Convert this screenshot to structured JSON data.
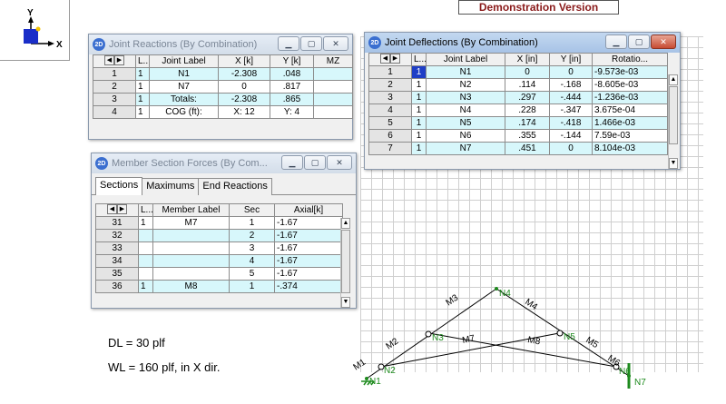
{
  "axis": {
    "y_label": "Y",
    "x_label": "X"
  },
  "banner": {
    "text": "Demonstration Version"
  },
  "app_icon_text": "2D",
  "joint_reactions": {
    "title": "Joint Reactions (By Combination)",
    "columns": [
      "L...",
      "Joint Label",
      "X [k]",
      "Y [k]",
      "MZ"
    ],
    "rows": [
      {
        "n": "1",
        "l": "1",
        "label": "N1",
        "x": "-2.308",
        "y": ".048",
        "mz": ""
      },
      {
        "n": "2",
        "l": "1",
        "label": "N7",
        "x": "0",
        "y": ".817",
        "mz": ""
      },
      {
        "n": "3",
        "l": "1",
        "label": "Totals:",
        "x": "-2.308",
        "y": ".865",
        "mz": ""
      },
      {
        "n": "4",
        "l": "1",
        "label": "COG (ft):",
        "x": "X: 12",
        "y": "Y: 4",
        "mz": ""
      }
    ]
  },
  "joint_deflections": {
    "title": "Joint Deflections (By Combination)",
    "columns": [
      "L...",
      "Joint Label",
      "X [in]",
      "Y [in]",
      "Rotatio..."
    ],
    "rows": [
      {
        "n": "1",
        "l": "1",
        "label": "N1",
        "x": "0",
        "y": "0",
        "r": "-9.573e-03"
      },
      {
        "n": "2",
        "l": "1",
        "label": "N2",
        "x": ".114",
        "y": "-.168",
        "r": "-8.605e-03"
      },
      {
        "n": "3",
        "l": "1",
        "label": "N3",
        "x": ".297",
        "y": "-.444",
        "r": "-1.236e-03"
      },
      {
        "n": "4",
        "l": "1",
        "label": "N4",
        "x": ".228",
        "y": "-.347",
        "r": "3.675e-04"
      },
      {
        "n": "5",
        "l": "1",
        "label": "N5",
        "x": ".174",
        "y": "-.418",
        "r": "1.466e-03"
      },
      {
        "n": "6",
        "l": "1",
        "label": "N6",
        "x": ".355",
        "y": "-.144",
        "r": "7.59e-03"
      },
      {
        "n": "7",
        "l": "1",
        "label": "N7",
        "x": ".451",
        "y": "0",
        "r": "8.104e-03"
      }
    ]
  },
  "member_forces": {
    "title": "Member Section Forces (By Com...",
    "tabs": [
      "Sections",
      "Maximums",
      "End Reactions"
    ],
    "columns": [
      "L...",
      "Member Label",
      "Sec",
      "Axial[k]"
    ],
    "rows": [
      {
        "n": "31",
        "l": "1",
        "label": "M7",
        "sec": "1",
        "axial": "-1.67"
      },
      {
        "n": "32",
        "l": "",
        "label": "",
        "sec": "2",
        "axial": "-1.67"
      },
      {
        "n": "33",
        "l": "",
        "label": "",
        "sec": "3",
        "axial": "-1.67"
      },
      {
        "n": "34",
        "l": "",
        "label": "",
        "sec": "4",
        "axial": "-1.67"
      },
      {
        "n": "35",
        "l": "",
        "label": "",
        "sec": "5",
        "axial": "-1.67"
      },
      {
        "n": "36",
        "l": "1",
        "label": "M8",
        "sec": "1",
        "axial": "-.374"
      }
    ]
  },
  "loads": {
    "dl": "DL = 30 plf",
    "wl": "WL = 160 plf,  in X dir."
  },
  "model": {
    "nodes": [
      "N1",
      "N2",
      "N3",
      "N4",
      "N5",
      "N6",
      "N7"
    ],
    "members": [
      "M1",
      "M2",
      "M3",
      "M4",
      "M5",
      "M6",
      "M7",
      "M8"
    ]
  }
}
